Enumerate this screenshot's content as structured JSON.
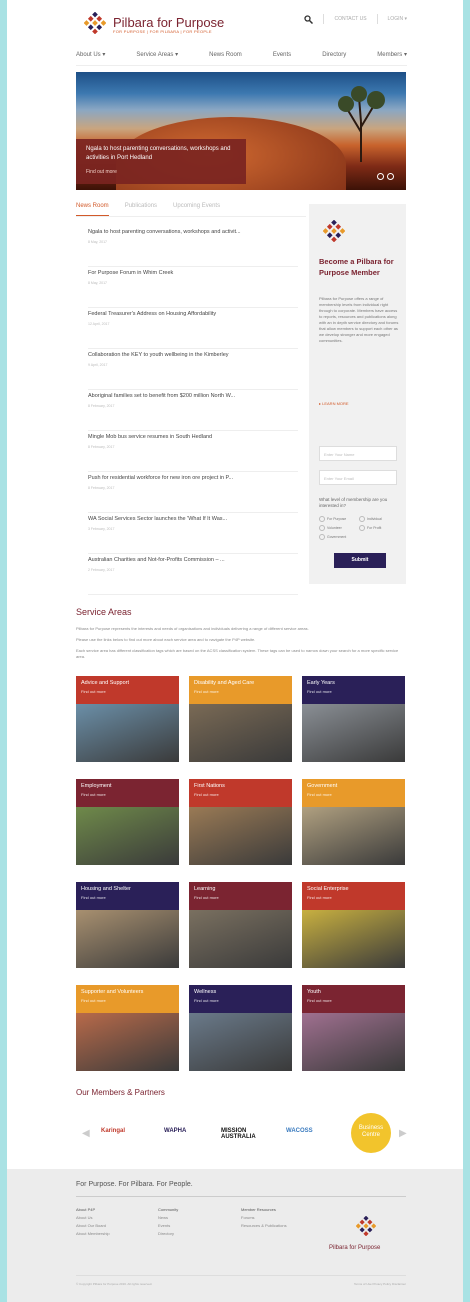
{
  "header": {
    "brand": "Pilbara for Purpose",
    "brand_sub": "FOR PURPOSE  |  FOR PILBARA  |  FOR PEOPLE",
    "contact": "CONTACT US",
    "login": "LOGIN ▾"
  },
  "nav": [
    "About Us ▾",
    "Service Areas ▾",
    "News Room",
    "Events",
    "Directory",
    "Members ▾"
  ],
  "hero": {
    "title": "Ngala to host parenting conversations, workshops and activities in Port Hedland",
    "link": "Find out more"
  },
  "tabs": [
    "News Room",
    "Publications",
    "Upcoming Events"
  ],
  "news": [
    {
      "title": "Ngala to host parenting conversations, workshops and activit...",
      "date": "8 May, 2017"
    },
    {
      "title": "For Purpose Forum in Whim Creek",
      "date": "8 May, 2017"
    },
    {
      "title": "Federal Treasurer's Address on Housing Affordability",
      "date": "12 April, 2017"
    },
    {
      "title": "Collaboration the KEY to youth wellbeing in the Kimberley",
      "date": "9 April, 2017"
    },
    {
      "title": "Aboriginal families set to benefit from $200 million North W...",
      "date": "8 February, 2017"
    },
    {
      "title": "Mingle Mob bus service resumes in South Hedland",
      "date": "8 February, 2017"
    },
    {
      "title": "Push for residential workforce for new iron ore project in P...",
      "date": "8 February, 2017"
    },
    {
      "title": "WA Social Services Sector launches the 'What If It Was...",
      "date": "3 February, 2017"
    },
    {
      "title": "Australian Charities and Not-for-Profits Commission – ...",
      "date": "2 February, 2017"
    }
  ],
  "sidebar": {
    "title": "Become a Pilbara for Purpose Member",
    "text": "Pilbara for Purpose offers a range of membership levels from individual right through to corporate. Members have access to reports, resources and publications along with an in depth service directory and forums that allow members to support each other as we develop stronger and more engaged communities.",
    "learn_more": "▸ LEARN MORE",
    "name_placeholder": "Enter Your Name",
    "email_placeholder": "Enter Your Email",
    "question": "What level of membership are you interested in?",
    "options": [
      "For Purpose",
      "Individual",
      "Volunteer",
      "For Profit",
      "Government"
    ],
    "submit": "Submit"
  },
  "service_areas": {
    "title": "Service Areas",
    "p1": "Pilbara for Purpose represents the interests and needs of organisations and individuals delivering a range of different service areas.",
    "p2": "Please use the links below to find out more about each service area and to navigate the P4P website.",
    "p3": "Each service area has different classification tags which are based on the ACSS classification system. These tags can be used to narrow down your search for a more specific service area.",
    "find_out_more": "Find out more",
    "tiles": [
      {
        "name": "Advice and Support",
        "color": "#c0392b"
      },
      {
        "name": "Disability and Aged Care",
        "color": "#e89a2a"
      },
      {
        "name": "Early Years",
        "color": "#2a2058"
      },
      {
        "name": "Employment",
        "color": "#7b2431"
      },
      {
        "name": "First Nations",
        "color": "#c0392b"
      },
      {
        "name": "Government",
        "color": "#e89a2a"
      },
      {
        "name": "Housing and Shelter",
        "color": "#2a2058"
      },
      {
        "name": "Learning",
        "color": "#7b2431"
      },
      {
        "name": "Social Enterprise",
        "color": "#c0392b"
      },
      {
        "name": "Supporter and Volunteers",
        "color": "#e89a2a"
      },
      {
        "name": "Wellness",
        "color": "#2a2058"
      },
      {
        "name": "Youth",
        "color": "#7b2431"
      }
    ]
  },
  "partners": {
    "title": "Our Members & Partners",
    "logos": [
      "Karingal",
      "WAPHA",
      "MISSION AUSTRALIA",
      "WACOSS",
      "Business Centre"
    ]
  },
  "footer": {
    "tagline": "For Purpose. For Pilbara. For People.",
    "col1": {
      "head": "About P4P",
      "items": [
        "About Us",
        "About Our Board",
        "About Membership"
      ]
    },
    "col2": {
      "head": "Community",
      "items": [
        "News",
        "Events",
        "Directory"
      ]
    },
    "col3": {
      "head": "Member Resources",
      "items": [
        "Forums",
        "Resources & Publications"
      ]
    },
    "brand": "Pilbara for Purpose",
    "copyright": "© Copyright Pilbara for Purpose 2016. All rights reserved.",
    "links": "Terms of Use    Privacy Policy    Disclaimer"
  }
}
